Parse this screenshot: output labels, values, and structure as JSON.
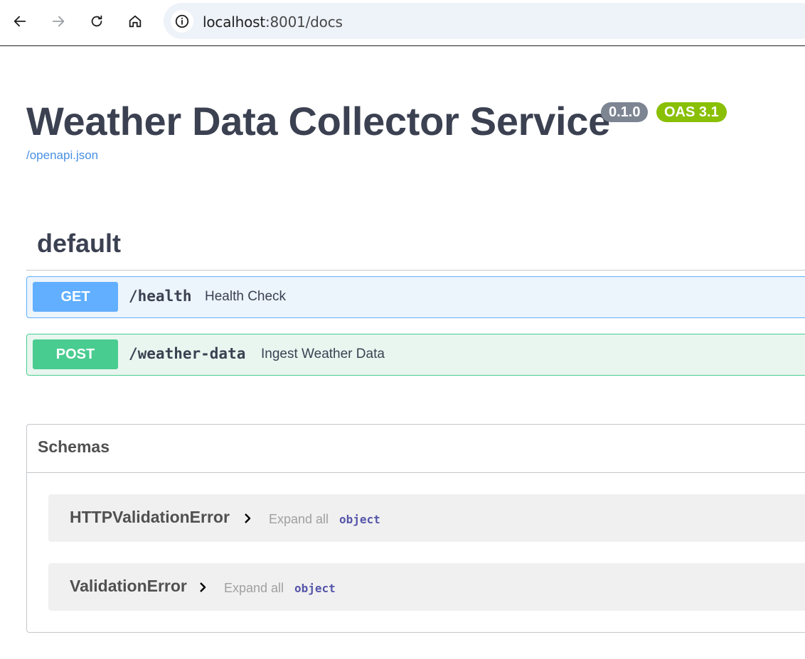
{
  "browser": {
    "url_host": "localhost",
    "url_rest": ":8001/docs"
  },
  "info": {
    "title": "Weather Data Collector Service",
    "version": "0.1.0",
    "oas": "OAS 3.1",
    "spec_link": "/openapi.json"
  },
  "tag": {
    "name": "default"
  },
  "operations": [
    {
      "method": "GET",
      "path": "/health",
      "summary": "Health Check"
    },
    {
      "method": "POST",
      "path": "/weather-data",
      "summary": "Ingest Weather Data"
    }
  ],
  "schemas": {
    "title": "Schemas",
    "models": [
      {
        "name": "HTTPValidationError",
        "expand": "Expand all",
        "type": "object"
      },
      {
        "name": "ValidationError",
        "expand": "Expand all",
        "type": "object"
      }
    ]
  },
  "colors": {
    "get": "#61affe",
    "post": "#49cc90",
    "version_badge": "#7d8492",
    "oas_badge": "#89bf04",
    "link": "#4990e2"
  }
}
